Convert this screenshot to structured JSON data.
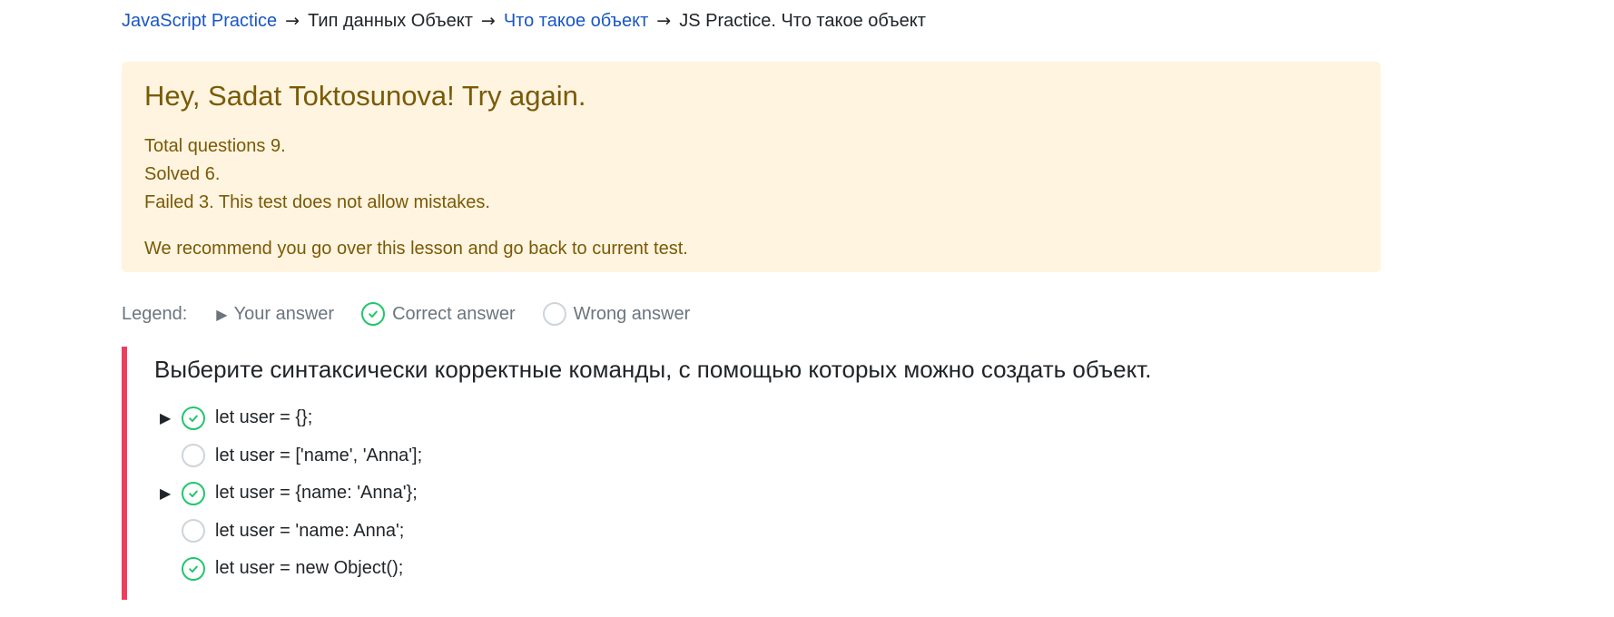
{
  "breadcrumb": {
    "items": [
      {
        "label": "JavaScript Practice",
        "link": true
      },
      {
        "label": "Тип данных Объект",
        "link": false
      },
      {
        "label": "Что такое объект",
        "link": true
      },
      {
        "label": "JS Practice. Что такое объект",
        "link": false
      }
    ],
    "separator": "→"
  },
  "alert": {
    "title": "Hey, Sadat Toktosunova! Try again.",
    "total": "Total questions 9.",
    "solved": "Solved 6.",
    "failed": "Failed 3. This test does not allow mistakes.",
    "recommend": "We recommend you go over this lesson and go back to current test.",
    "colors": {
      "background": "#fff4e0",
      "text": "#7a5a06"
    }
  },
  "legend": {
    "title": "Legend:",
    "your_answer": "Your answer",
    "correct_answer": "Correct answer",
    "wrong_answer": "Wrong answer",
    "icons": [
      "triangle-right-icon",
      "check-circle-icon",
      "empty-circle-icon"
    ]
  },
  "question": {
    "title": "Выберите синтаксически корректные команды, с помощью которых можно создать объект.",
    "accent_color": "#ef3d5e",
    "answers": [
      {
        "text": "let user = {};",
        "selected": true,
        "correct": true
      },
      {
        "text": "let user = ['name', 'Anna'];",
        "selected": false,
        "correct": false
      },
      {
        "text": "let user = {name: 'Anna'};",
        "selected": true,
        "correct": true
      },
      {
        "text": "let user = 'name: Anna';",
        "selected": false,
        "correct": false
      },
      {
        "text": "let user = new Object();",
        "selected": false,
        "correct": true
      }
    ]
  },
  "colors": {
    "link": "#1a56c4",
    "correct": "#20c76c",
    "neutral_circle": "#ced4da",
    "muted": "#6c757d"
  }
}
